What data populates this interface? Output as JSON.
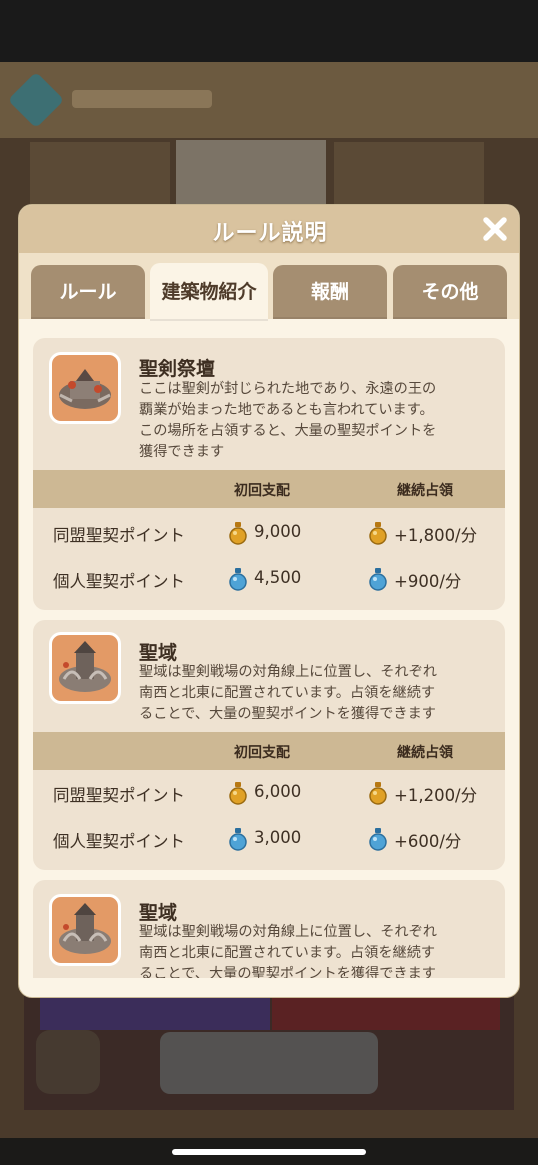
{
  "dialog": {
    "title": "ルール説明",
    "tabs": [
      {
        "label": "ルール",
        "active": false
      },
      {
        "label": "建築物紹介",
        "active": true
      },
      {
        "label": "報酬",
        "active": false
      },
      {
        "label": "その他",
        "active": false
      }
    ]
  },
  "table_headers": {
    "first": "初回支配",
    "continuous": "継続占領"
  },
  "buildings": [
    {
      "name": "聖剣祭壇",
      "description_lines": [
        "ここは聖剣が封じられた地であり、永遠の王の",
        "覇業が始まった地であるとも言われています。",
        "この場所を占領すると、大量の聖契ポイントを",
        "獲得できます"
      ],
      "rows": [
        {
          "label": "同盟聖契ポイント",
          "icon": "gold-potion-icon",
          "first": "9,000",
          "continuous": "+1,800/分"
        },
        {
          "label": "個人聖契ポイント",
          "icon": "blue-potion-icon",
          "first": "4,500",
          "continuous": "+900/分"
        }
      ]
    },
    {
      "name": "聖域",
      "description_lines": [
        "聖域は聖剣戦場の対角線上に位置し、それぞれ",
        "南西と北東に配置されています。占領を継続す",
        "ることで、大量の聖契ポイントを獲得できます"
      ],
      "rows": [
        {
          "label": "同盟聖契ポイント",
          "icon": "gold-potion-icon",
          "first": "6,000",
          "continuous": "+1,200/分"
        },
        {
          "label": "個人聖契ポイント",
          "icon": "blue-potion-icon",
          "first": "3,000",
          "continuous": "+600/分"
        }
      ]
    },
    {
      "name": "聖域",
      "description_lines": [
        "聖域は聖剣戦場の対角線上に位置し、それぞれ",
        "南西と北東に配置されています。占領を継続す",
        "ることで、大量の聖契ポイントを獲得できます"
      ]
    }
  ],
  "colors": {
    "gold_potion": "#e0a126",
    "blue_potion": "#4fa3d6",
    "header_bar": "#cdb894"
  }
}
